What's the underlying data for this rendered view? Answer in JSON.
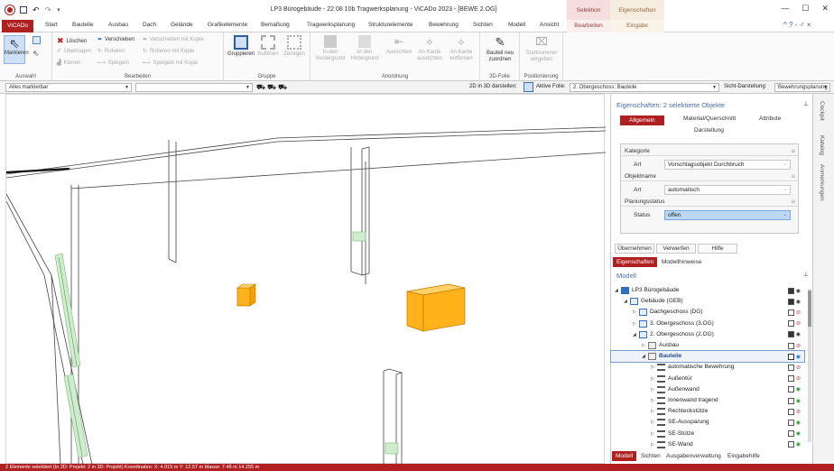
{
  "title_bar": {
    "title": "LP3 Bürogebäude - 22 08 10b Tragwerksplanung - ViCADo 2023 - [BEWE 2.OG]",
    "context_selection": "Selektion",
    "context_properties": "Eigenschaften",
    "win_min": "—",
    "win_max": "☐",
    "win_close": "✕"
  },
  "tabs": {
    "app": "ViCADo",
    "items": [
      "Start",
      "Bauteile",
      "Ausbau",
      "Dach",
      "Gelände",
      "Grafikelemente",
      "Bemaßung",
      "Tragwerksplanung",
      "Strukturelemente",
      "Bewehrung",
      "Sichten",
      "Modell",
      "Ansicht"
    ],
    "ctx_edit": "Bearbeiten",
    "ctx_input": "Eingabe",
    "right_controls": "^ ? - ♂ ×"
  },
  "ribbon": {
    "select": {
      "label": "Markieren",
      "group": "Auswahl"
    },
    "edit": {
      "group": "Bearbeiten",
      "delete": "Löschen",
      "move": "Verschieben",
      "move_copy": "Verschieben mit Kopie",
      "transfer": "Übertragen",
      "rotate": "Rotieren",
      "rotate_copy": "Rotieren mit Kopie",
      "clone": "Klonen",
      "mirror": "Spiegeln",
      "mirror_copy": "Spiegeln mit Kopie"
    },
    "group_grp": {
      "group": "Gruppe",
      "group_btn": "Gruppieren",
      "dissolve": "Auflösen",
      "decompose": "Zerlegen"
    },
    "arrange": {
      "group": "Anordnung",
      "front": "In den\nVordergrund",
      "back": "In den\nHintergrund",
      "align": "Ausrichten",
      "edge_align": "An Kante\nausrichten",
      "edge_remove": "An Kante\nentfernen"
    },
    "folie": {
      "group": "3D-Folie",
      "reassign": "Bauteil neu\nzuordnen"
    },
    "position": {
      "group": "Positionierung",
      "start_number": "Startnummer\nvergeben"
    }
  },
  "toolbar2": {
    "filter": "Alles markierbar",
    "combo2": "",
    "show2d3d": "2D in 3D darstellen:",
    "active_folie_label": "Aktive Folie:",
    "active_folie": "2. Obergeschoss: Bauteile",
    "view_label": "Sicht-Darstellung:",
    "view_value": "Bewehrungsplanung"
  },
  "props": {
    "title": "Eigenschaften: 2 selektierte Objekte",
    "tabs": [
      "Allgemein",
      "Material/Querschnitt",
      "Attribute",
      "Darstellung"
    ],
    "sections": [
      {
        "name": "Kategorie",
        "label": "Art",
        "value": "Vorschlagsobjekt Durchbruch"
      },
      {
        "name": "Objektname",
        "label": "Art",
        "value": "automatisch"
      },
      {
        "name": "Planungsstatus",
        "label": "Status",
        "value": "offen"
      }
    ],
    "action_buttons": [
      "Übernehmen",
      "Verwerfen",
      "Hilfe"
    ],
    "bottom_tabs": [
      "Eigenschaften",
      "Modellhinweise"
    ]
  },
  "model": {
    "title": "Modell",
    "rows": [
      {
        "label": "LP3 Bürogebäude",
        "level": 0,
        "toggle": "◢",
        "eye": "on"
      },
      {
        "label": "Gebäude (GEB)",
        "level": 1,
        "toggle": "◢",
        "eye": "on"
      },
      {
        "label": "Dachgeschoss (DG)",
        "level": 2,
        "toggle": "▷",
        "eye": "off"
      },
      {
        "label": "3. Obergeschoss (3.OG)",
        "level": 2,
        "toggle": "▷",
        "eye": "off"
      },
      {
        "label": "2. Obergeschoss (2.OG)",
        "level": 2,
        "toggle": "◢",
        "eye": "on"
      },
      {
        "label": "Ausbau",
        "level": 3,
        "toggle": "▷",
        "eye": "off"
      },
      {
        "label": "Bauteile",
        "level": 3,
        "toggle": "◢",
        "eye": "blue"
      },
      {
        "label": "automatische Bewehrung",
        "level": 4,
        "toggle": "▷",
        "eye": "off"
      },
      {
        "label": "Außentür",
        "level": 4,
        "toggle": "▷",
        "eye": "off"
      },
      {
        "label": "Außenwand",
        "level": 4,
        "toggle": "▷",
        "eye": "green"
      },
      {
        "label": "Innenwand tragend",
        "level": 4,
        "toggle": "▷",
        "eye": "green"
      },
      {
        "label": "Rechteckstütze",
        "level": 4,
        "toggle": "▷",
        "eye": "off"
      },
      {
        "label": "SE-Aussparung",
        "level": 4,
        "toggle": "▷",
        "eye": "green"
      },
      {
        "label": "SE-Stütze",
        "level": 4,
        "toggle": "▷",
        "eye": "green"
      },
      {
        "label": "SE-Wand",
        "level": 4,
        "toggle": "▷",
        "eye": "green"
      }
    ],
    "bottom_tabs": [
      "Modell",
      "Sichten",
      "Ausgabenverwaltung",
      "Eingabehilfe"
    ]
  },
  "side_strip": [
    "Cockpit",
    "Katalog",
    "Anmerkungen"
  ],
  "status": "2 Elemente selektiert (In 2D: Projekt: 2 in 3D: Projekt)     Koordinaten: X: 4.015 m  Y: 12.57 m     Masse: 7.48 m     14.155 m"
}
